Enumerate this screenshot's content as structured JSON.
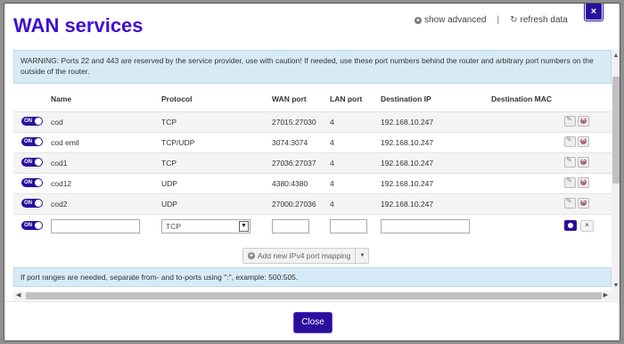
{
  "dialog": {
    "title": "WAN services",
    "show_advanced": "show advanced",
    "separator": "|",
    "refresh": "refresh data",
    "close_x": "×",
    "warning": "WARNING: Ports 22 and 443 are reserved by the service provider, use with caution! If needed, use these port numbers behind the router and arbitrary port numbers on the outside of the router.",
    "info": "If port ranges are needed, separate from- and to-ports using \":\", example: 500:505.",
    "close_label": "Close"
  },
  "table": {
    "headers": [
      "Name",
      "Protocol",
      "WAN port",
      "LAN port",
      "Destination IP",
      "Destination MAC"
    ],
    "rows": [
      {
        "toggle": "ON",
        "name": "cod",
        "protocol": "TCP",
        "wan": "27015:27030",
        "lan": "4",
        "ip": "192.168.10.247",
        "mac": ""
      },
      {
        "toggle": "ON",
        "name": "cod emil",
        "protocol": "TCP/UDP",
        "wan": "3074:3074",
        "lan": "4",
        "ip": "192.168.10.247",
        "mac": ""
      },
      {
        "toggle": "ON",
        "name": "cod1",
        "protocol": "TCP",
        "wan": "27036:27037",
        "lan": "4",
        "ip": "192.168.10.247",
        "mac": ""
      },
      {
        "toggle": "ON",
        "name": "cod12",
        "protocol": "UDP",
        "wan": "4380:4380",
        "lan": "4",
        "ip": "192.168.10.247",
        "mac": ""
      },
      {
        "toggle": "ON",
        "name": "cod2",
        "protocol": "UDP",
        "wan": "27000:27036",
        "lan": "4",
        "ip": "192.168.10.247",
        "mac": ""
      }
    ],
    "new_row": {
      "toggle": "ON",
      "protocol": "TCP",
      "cancel": "×"
    }
  },
  "add_button": {
    "label": "Add new IPv4 port mapping",
    "caret": "▼"
  },
  "colors": {
    "accent": "#2a0f9e",
    "title": "#3d0fd1",
    "info_bg": "#d7ebf6"
  },
  "icons": {
    "plus": "+",
    "refresh": "↻"
  }
}
